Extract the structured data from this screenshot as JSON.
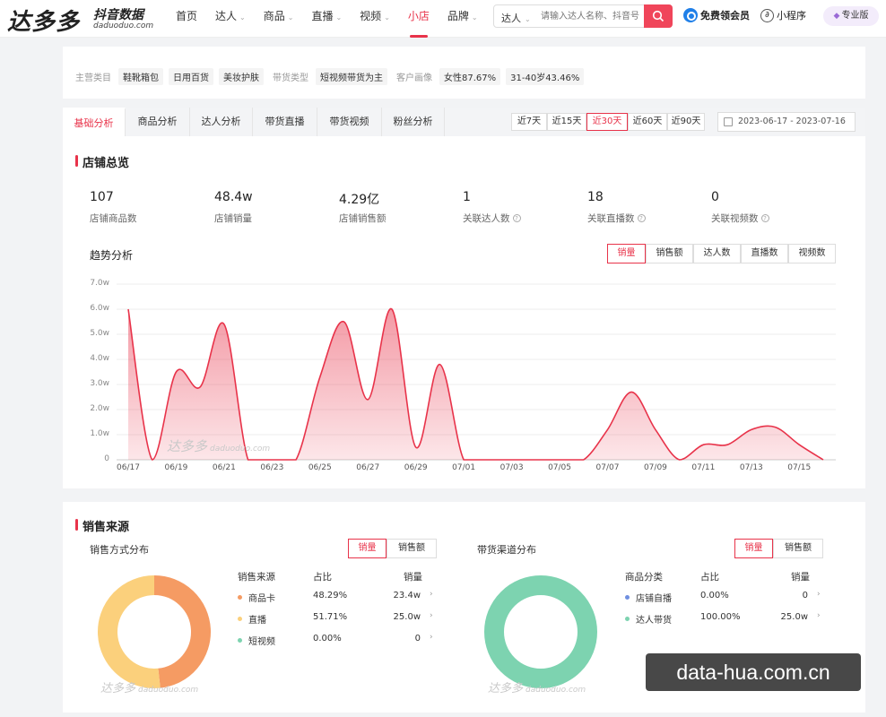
{
  "logo": {
    "main": "达多多",
    "sub": "抖音数据",
    "domain": "daduoduo.com"
  },
  "nav": [
    {
      "label": "首页",
      "chev": false
    },
    {
      "label": "达人",
      "chev": true
    },
    {
      "label": "商品",
      "chev": true
    },
    {
      "label": "直播",
      "chev": true
    },
    {
      "label": "视频",
      "chev": true
    },
    {
      "label": "小店",
      "chev": false,
      "active": true
    },
    {
      "label": "品牌",
      "chev": true
    }
  ],
  "search": {
    "type": "达人",
    "placeholder": "请输入达人名称、抖音号"
  },
  "header": {
    "member": "免费领会员",
    "mini": "小程序",
    "pro": "专业版"
  },
  "tags": {
    "main_label": "主营类目",
    "main": [
      "鞋靴箱包",
      "日用百货",
      "美妆护肤"
    ],
    "type_label": "带货类型",
    "type": [
      "短视频带货为主"
    ],
    "customer_label": "客户画像",
    "customer": [
      "女性87.67%",
      "31-40岁43.46%"
    ]
  },
  "tabs": [
    "基础分析",
    "商品分析",
    "达人分析",
    "带货直播",
    "带货视频",
    "粉丝分析"
  ],
  "ranges": [
    "近7天",
    "近15天",
    "近30天",
    "近60天",
    "近90天"
  ],
  "date_range": "2023-06-17 - 2023-07-16",
  "overview": {
    "title": "店铺总览",
    "stats": [
      {
        "value": "107",
        "label": "店铺商品数",
        "help": false
      },
      {
        "value": "48.4w",
        "label": "店铺销量",
        "help": false
      },
      {
        "value": "4.29亿",
        "label": "店铺销售额",
        "help": false
      },
      {
        "value": "1",
        "label": "关联达人数",
        "help": true
      },
      {
        "value": "18",
        "label": "关联直播数",
        "help": true
      },
      {
        "value": "0",
        "label": "关联视频数",
        "help": true
      }
    ]
  },
  "trend": {
    "title": "趋势分析",
    "metrics": [
      "销量",
      "销售额",
      "达人数",
      "直播数",
      "视频数"
    ]
  },
  "chart_data": {
    "type": "area",
    "x": [
      "06/17",
      "06/18",
      "06/19",
      "06/20",
      "06/21",
      "06/22",
      "06/23",
      "06/24",
      "06/25",
      "06/26",
      "06/27",
      "06/28",
      "06/29",
      "06/30",
      "07/01",
      "07/02",
      "07/03",
      "07/04",
      "07/05",
      "07/06",
      "07/07",
      "07/08",
      "07/09",
      "07/10",
      "07/11",
      "07/12",
      "07/13",
      "07/14",
      "07/15",
      "07/16"
    ],
    "values": [
      6.0,
      0.0,
      3.5,
      2.9,
      5.4,
      0.0,
      0.0,
      0.0,
      3.3,
      5.5,
      2.4,
      6.0,
      0.5,
      3.8,
      0.0,
      0.0,
      0.0,
      0.0,
      0.0,
      0.0,
      1.2,
      2.7,
      1.2,
      0.0,
      0.6,
      0.6,
      1.2,
      1.3,
      0.6,
      0.0
    ],
    "x_tick_labels": [
      "06/17",
      "06/19",
      "06/21",
      "06/23",
      "06/25",
      "06/27",
      "06/29",
      "07/01",
      "07/03",
      "07/05",
      "07/07",
      "07/09",
      "07/11",
      "07/13",
      "07/15"
    ],
    "y_ticks": [
      "0",
      "1.0w",
      "2.0w",
      "3.0w",
      "4.0w",
      "5.0w",
      "6.0w",
      "7.0w"
    ],
    "ylim": [
      0,
      7
    ],
    "grid": true,
    "color": "#e8334a"
  },
  "watermark": {
    "text": "达多多",
    "domain": "daduoduo.com"
  },
  "sales": {
    "title": "销售来源",
    "method": {
      "title": "销售方式分布",
      "toggle": [
        "销量",
        "销售额"
      ],
      "headers": [
        "销售来源",
        "占比",
        "销量"
      ],
      "rows": [
        {
          "name": "商品卡",
          "pct": "48.29%",
          "val": "23.4w",
          "color": "#f59b63"
        },
        {
          "name": "直播",
          "pct": "51.71%",
          "val": "25.0w",
          "color": "#fbd07c"
        },
        {
          "name": "短视频",
          "pct": "0.00%",
          "val": "0",
          "color": "#7dd3b0"
        }
      ],
      "donut": [
        48.29,
        51.71,
        0.0
      ]
    },
    "channel": {
      "title": "带货渠道分布",
      "toggle": [
        "销量",
        "销售额"
      ],
      "headers": [
        "商品分类",
        "占比",
        "销量"
      ],
      "rows": [
        {
          "name": "店铺自播",
          "pct": "0.00%",
          "val": "0",
          "color": "#6f8fe0"
        },
        {
          "name": "达人带货",
          "pct": "100.00%",
          "val": "25.0w",
          "color": "#7dd3b0"
        }
      ],
      "donut": [
        0.0,
        100.0
      ]
    }
  },
  "overlay_domain": "data-hua.com.cn"
}
